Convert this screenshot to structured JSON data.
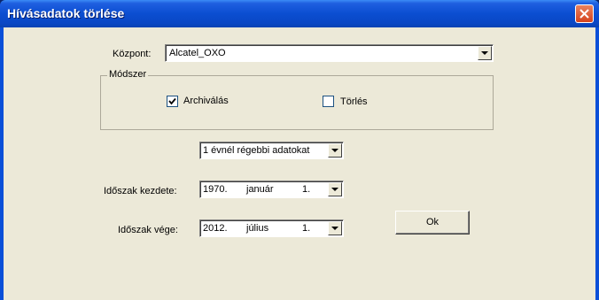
{
  "window": {
    "title": "Hívásadatok törlése"
  },
  "kozpont": {
    "label": "Központ:",
    "value": "Alcatel_OXO"
  },
  "modszer": {
    "title": "Módszer",
    "archivalas": {
      "label": "Archiválás",
      "checked": true
    },
    "torles": {
      "label": "Törlés",
      "checked": false
    }
  },
  "filter": {
    "value": "1 évnél régebbi adatokat"
  },
  "start": {
    "label": "Időszak kezdete:",
    "year": "1970.",
    "month": "január",
    "day": "1."
  },
  "end": {
    "label": "Időszak vége:",
    "year": "2012.",
    "month": "július",
    "day": "1."
  },
  "ok_button": {
    "label": "Ok"
  }
}
